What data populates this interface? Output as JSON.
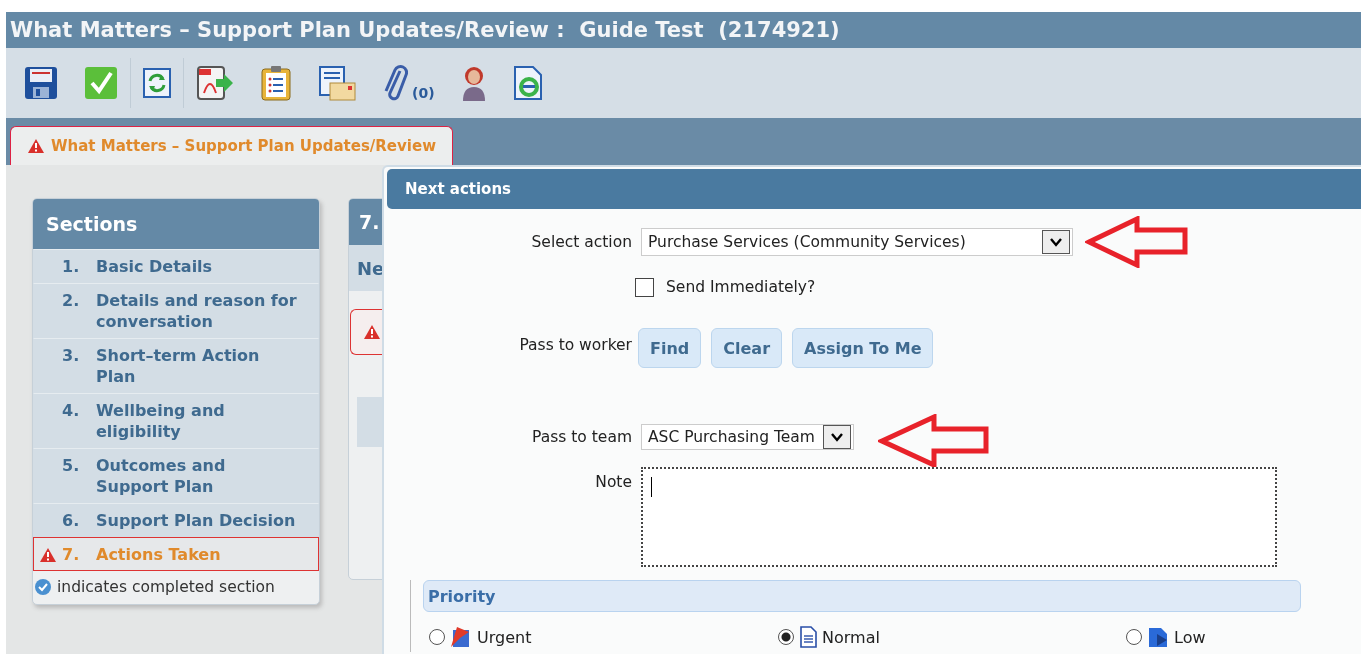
{
  "window": {
    "title": "What Matters – Support Plan Updates/Review :  Guide Test  (2174921)"
  },
  "toolbar": {
    "attachments_count": "(0)"
  },
  "tabs": [
    {
      "label": "What Matters – Support Plan Updates/Review",
      "selected": true,
      "warning": true
    }
  ],
  "sections": {
    "title": "Sections",
    "items": [
      {
        "number": "1.",
        "label": "Basic Details",
        "selected": false,
        "warning": false
      },
      {
        "number": "2.",
        "label": "Details and reason for conversation",
        "selected": false,
        "warning": false
      },
      {
        "number": "3.",
        "label": "Short–term Action Plan",
        "selected": false,
        "warning": false
      },
      {
        "number": "4.",
        "label": "Wellbeing and eligibility",
        "selected": false,
        "warning": false
      },
      {
        "number": "5.",
        "label": "Outcomes and Support Plan",
        "selected": false,
        "warning": false
      },
      {
        "number": "6.",
        "label": "Support Plan Decision",
        "selected": false,
        "warning": false
      },
      {
        "number": "7.",
        "label": "Actions Taken",
        "selected": true,
        "warning": true
      }
    ],
    "legend": "indicates completed section"
  },
  "background_panel": {
    "title": "7.",
    "subtitle": "Ne"
  },
  "dialog": {
    "title": "Next actions",
    "select_action": {
      "label": "Select action",
      "value": "Purchase Services (Community Services)"
    },
    "send_immediately": {
      "label": "Send Immediately?",
      "checked": false
    },
    "pass_to_worker": {
      "label": "Pass to worker",
      "buttons": [
        "Find",
        "Clear",
        "Assign To Me"
      ]
    },
    "pass_to_team": {
      "label": "Pass to team",
      "value": "ASC Purchasing Team"
    },
    "note": {
      "label": "Note"
    },
    "priority": {
      "title": "Priority",
      "options": [
        {
          "label": "Urgent",
          "kind": "urgent",
          "selected": false
        },
        {
          "label": "Normal",
          "kind": "normal",
          "selected": true
        },
        {
          "label": "Low",
          "kind": "low",
          "selected": false
        }
      ]
    }
  }
}
